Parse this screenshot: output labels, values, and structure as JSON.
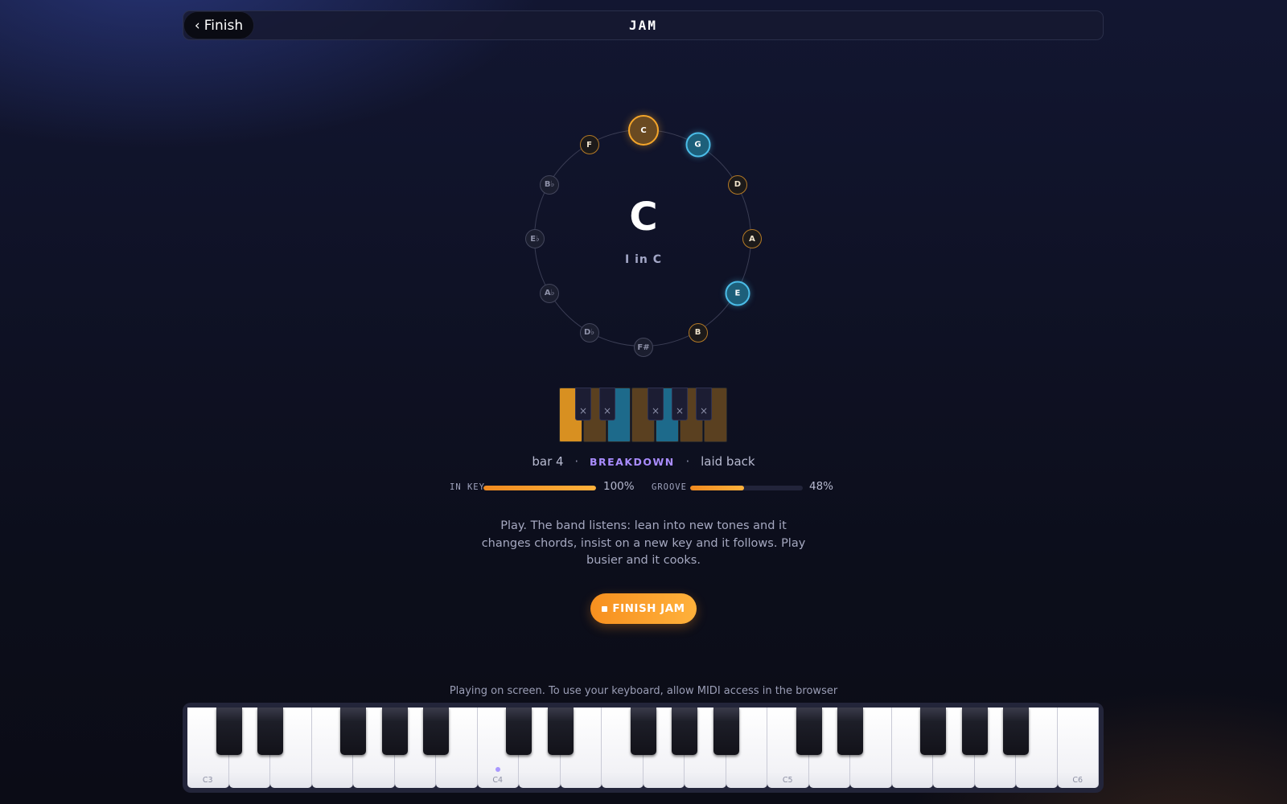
{
  "header": {
    "back_label": "Finish",
    "back_icon": "‹",
    "title": "JAM"
  },
  "circle": {
    "chord": "C",
    "roman": "I in C",
    "notes": [
      {
        "name": "C",
        "state": "root"
      },
      {
        "name": "G",
        "state": "chord"
      },
      {
        "name": "D",
        "state": "scale"
      },
      {
        "name": "A",
        "state": "scale"
      },
      {
        "name": "E",
        "state": "chord"
      },
      {
        "name": "B",
        "state": "scale"
      },
      {
        "name": "F#",
        "state": "off"
      },
      {
        "name": "D♭",
        "state": "off"
      },
      {
        "name": "A♭",
        "state": "off"
      },
      {
        "name": "E♭",
        "state": "off"
      },
      {
        "name": "B♭",
        "state": "off"
      },
      {
        "name": "F",
        "state": "scale"
      }
    ]
  },
  "mini_keyboard": {
    "white_states": [
      "root",
      "scale",
      "chord",
      "scale",
      "chord",
      "scale",
      "scale"
    ],
    "black_mark": "×",
    "colors": {
      "root": "#d89021",
      "scale": "#5a4020",
      "chord": "#1d6a8b"
    }
  },
  "status": {
    "bar": "bar 4",
    "section": "BREAKDOWN",
    "feel": "laid back",
    "separator": "·"
  },
  "meters": {
    "in_key": {
      "label": "IN KEY",
      "value": 1.0,
      "text": "100%"
    },
    "groove": {
      "label": "GROOVE",
      "value": 0.48,
      "text": "48%"
    }
  },
  "instructions": "Play. The band listens: lean into new tones and it changes chords, insist on a new key and it follows. Play busier and it cooks.",
  "finish_button": {
    "label": "FINISH JAM"
  },
  "piano": {
    "notice": "Playing on screen. To use your keyboard, allow MIDI access in the browser",
    "white_keys": [
      "C3",
      "",
      "",
      "",
      "",
      "",
      "",
      "C4",
      "",
      "",
      "",
      "",
      "",
      "",
      "C5",
      "",
      "",
      "",
      "",
      "",
      "",
      "C6"
    ],
    "active_key_index": 7
  },
  "colors": {
    "accent": "#f7901f",
    "chord_blue": "#4bbde8",
    "section_purple": "#a98cff"
  }
}
